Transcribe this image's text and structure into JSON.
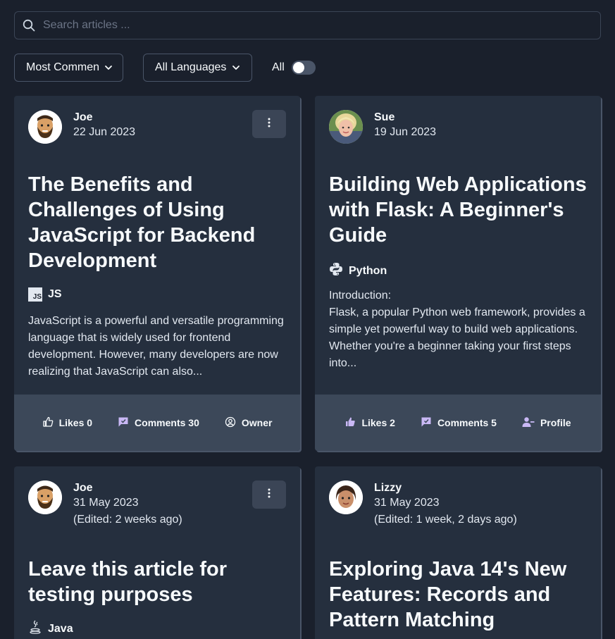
{
  "search": {
    "placeholder": "Search articles ..."
  },
  "filters": {
    "sort_label": "Most Commen",
    "language_label": "All Languages",
    "toggle_label": "All"
  },
  "colors": {
    "background": "#1a202c",
    "card": "#252f3e",
    "card_footer": "#3c4859",
    "accent_icon": "#c9b8f5"
  },
  "articles": [
    {
      "author": "Joe",
      "date": "22 Jun 2023",
      "edited": "",
      "title": "The Benefits and Challenges of Using JavaScript for Backend Development",
      "language": "JS",
      "excerpt": "JavaScript is a powerful and versatile programming language that is widely used for frontend development. However, many developers are now realizing that JavaScript can also...",
      "likes": "Likes 0",
      "comments": "Comments 30",
      "third_action": "Owner"
    },
    {
      "author": "Sue",
      "date": "19 Jun 2023",
      "edited": "",
      "title": "Building Web Applications with Flask: A Beginner's Guide",
      "language": "Python",
      "excerpt_intro": "Introduction:",
      "excerpt": "Flask, a popular Python web framework, provides a simple yet powerful way to build web applications. Whether you're a beginner taking your first steps into...",
      "likes": "Likes 2",
      "comments": "Comments 5",
      "third_action": "Profile"
    },
    {
      "author": "Joe",
      "date": "31 May 2023",
      "edited": "(Edited: 2 weeks ago)",
      "title": "Leave this article for testing purposes",
      "language": "Java"
    },
    {
      "author": "Lizzy",
      "date": "31 May 2023",
      "edited": "(Edited: 1 week, 2 days ago)",
      "title": "Exploring Java 14's New Features: Records and Pattern Matching"
    }
  ]
}
